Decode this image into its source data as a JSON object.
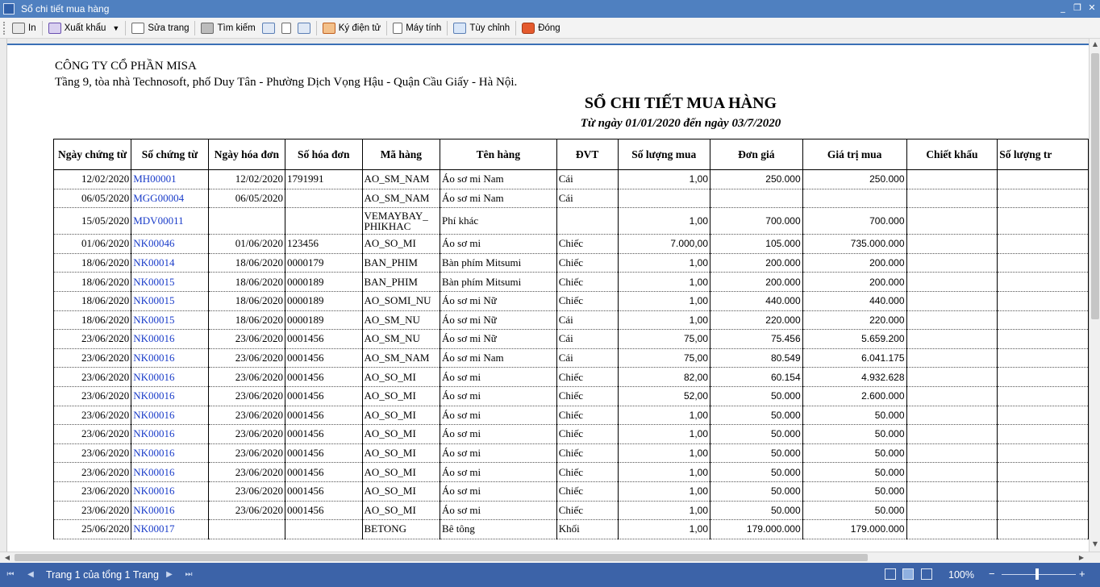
{
  "window": {
    "title": "Sổ chi tiết mua hàng",
    "minimize": "_",
    "restore": "❐",
    "close": "✕"
  },
  "toolbar": {
    "print": "In",
    "export": "Xuất khẩu",
    "edit": "Sửa trang",
    "search": "Tìm kiếm",
    "sign": "Ký điện tử",
    "calculator": "Máy tính",
    "customize": "Tùy chỉnh",
    "close": "Đóng"
  },
  "report": {
    "company": "CÔNG TY CỔ PHẦN MISA",
    "address": "Tầng 9, tòa nhà Technosoft, phố Duy Tân - Phường Dịch Vọng Hậu - Quận Cầu Giấy - Hà Nội.",
    "title": "SỔ CHI TIẾT MUA HÀNG",
    "subtitle": "Từ ngày 01/01/2020 đến ngày 03/7/2020",
    "columns": [
      "Ngày chứng từ",
      "Số chứng từ",
      "Ngày hóa đơn",
      "Số hóa đơn",
      "Mã hàng",
      "Tên hàng",
      "ĐVT",
      "Số lượng mua",
      "Đơn giá",
      "Giá trị mua",
      "Chiết khấu",
      "Số lượng tr"
    ],
    "rows": [
      [
        "12/02/2020",
        "MH00001",
        "12/02/2020",
        "1791991",
        "AO_SM_NAM",
        "Áo sơ mi Nam",
        "Cái",
        "1,00",
        "250.000",
        "250.000",
        "",
        ""
      ],
      [
        "06/05/2020",
        "MGG00004",
        "06/05/2020",
        "",
        "AO_SM_NAM",
        "Áo sơ mi Nam",
        "Cái",
        "",
        "",
        "",
        "",
        ""
      ],
      [
        "15/05/2020",
        "MDV00011",
        "",
        "",
        "VEMAYBAY_ PHIKHAC",
        "Phí khác",
        "",
        "1,00",
        "700.000",
        "700.000",
        "",
        ""
      ],
      [
        "01/06/2020",
        "NK00046",
        "01/06/2020",
        "123456",
        "AO_SO_MI",
        "Áo sơ mi",
        "Chiếc",
        "7.000,00",
        "105.000",
        "735.000.000",
        "",
        ""
      ],
      [
        "18/06/2020",
        "NK00014",
        "18/06/2020",
        "0000179",
        "BAN_PHIM",
        "Bàn phím Mitsumi",
        "Chiếc",
        "1,00",
        "200.000",
        "200.000",
        "",
        ""
      ],
      [
        "18/06/2020",
        "NK00015",
        "18/06/2020",
        "0000189",
        "BAN_PHIM",
        "Bàn phím Mitsumi",
        "Chiếc",
        "1,00",
        "200.000",
        "200.000",
        "",
        ""
      ],
      [
        "18/06/2020",
        "NK00015",
        "18/06/2020",
        "0000189",
        "AO_SOMI_NU",
        "Áo sơ mi Nữ",
        "Chiếc",
        "1,00",
        "440.000",
        "440.000",
        "",
        ""
      ],
      [
        "18/06/2020",
        "NK00015",
        "18/06/2020",
        "0000189",
        "AO_SM_NU",
        "Áo sơ mi Nữ",
        "Cái",
        "1,00",
        "220.000",
        "220.000",
        "",
        ""
      ],
      [
        "23/06/2020",
        "NK00016",
        "23/06/2020",
        "0001456",
        "AO_SM_NU",
        "Áo sơ mi Nữ",
        "Cái",
        "75,00",
        "75.456",
        "5.659.200",
        "",
        ""
      ],
      [
        "23/06/2020",
        "NK00016",
        "23/06/2020",
        "0001456",
        "AO_SM_NAM",
        "Áo sơ mi Nam",
        "Cái",
        "75,00",
        "80.549",
        "6.041.175",
        "",
        ""
      ],
      [
        "23/06/2020",
        "NK00016",
        "23/06/2020",
        "0001456",
        "AO_SO_MI",
        "Áo sơ mi",
        "Chiếc",
        "82,00",
        "60.154",
        "4.932.628",
        "",
        ""
      ],
      [
        "23/06/2020",
        "NK00016",
        "23/06/2020",
        "0001456",
        "AO_SO_MI",
        "Áo sơ mi",
        "Chiếc",
        "52,00",
        "50.000",
        "2.600.000",
        "",
        ""
      ],
      [
        "23/06/2020",
        "NK00016",
        "23/06/2020",
        "0001456",
        "AO_SO_MI",
        "Áo sơ mi",
        "Chiếc",
        "1,00",
        "50.000",
        "50.000",
        "",
        ""
      ],
      [
        "23/06/2020",
        "NK00016",
        "23/06/2020",
        "0001456",
        "AO_SO_MI",
        "Áo sơ mi",
        "Chiếc",
        "1,00",
        "50.000",
        "50.000",
        "",
        ""
      ],
      [
        "23/06/2020",
        "NK00016",
        "23/06/2020",
        "0001456",
        "AO_SO_MI",
        "Áo sơ mi",
        "Chiếc",
        "1,00",
        "50.000",
        "50.000",
        "",
        ""
      ],
      [
        "23/06/2020",
        "NK00016",
        "23/06/2020",
        "0001456",
        "AO_SO_MI",
        "Áo sơ mi",
        "Chiếc",
        "1,00",
        "50.000",
        "50.000",
        "",
        ""
      ],
      [
        "23/06/2020",
        "NK00016",
        "23/06/2020",
        "0001456",
        "AO_SO_MI",
        "Áo sơ mi",
        "Chiếc",
        "1,00",
        "50.000",
        "50.000",
        "",
        ""
      ],
      [
        "23/06/2020",
        "NK00016",
        "23/06/2020",
        "0001456",
        "AO_SO_MI",
        "Áo sơ mi",
        "Chiếc",
        "1,00",
        "50.000",
        "50.000",
        "",
        ""
      ],
      [
        "25/06/2020",
        "NK00017",
        "",
        "",
        "BETONG",
        "Bê tông",
        "Khối",
        "1,00",
        "179.000.000",
        "179.000.000",
        "",
        ""
      ]
    ]
  },
  "statusbar": {
    "page_info": "Trang 1 của tổng 1 Trang",
    "zoom": "100%",
    "zoom_out": "−",
    "zoom_in": "+"
  },
  "colors": {
    "titlebar": "#4f80c0",
    "statusbar": "#3c63a8",
    "link": "#1a3cc9"
  }
}
